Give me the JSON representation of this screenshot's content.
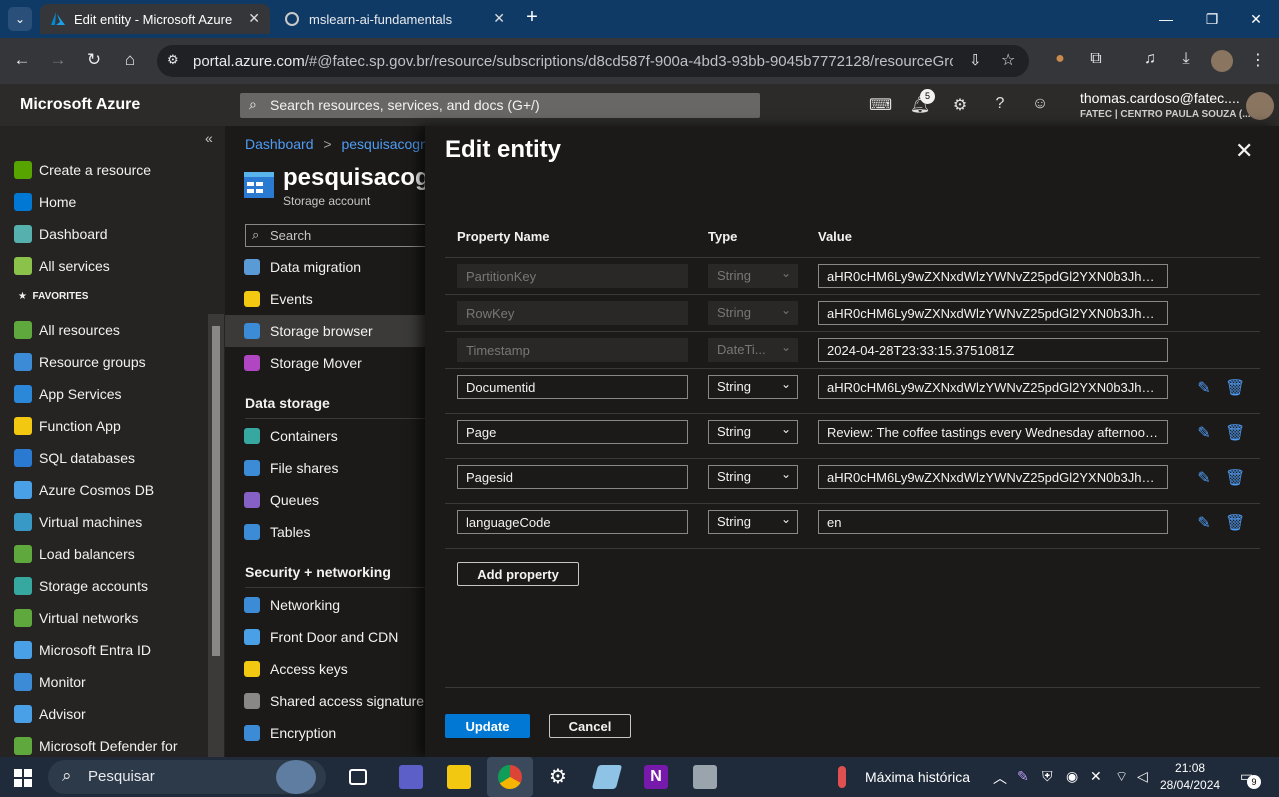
{
  "browser": {
    "tabs": [
      {
        "title": "Edit entity - Microsoft Azure",
        "active": true
      },
      {
        "title": "mslearn-ai-fundamentals",
        "active": false
      }
    ],
    "new_tab": "+",
    "url_host": "portal.azure.com",
    "url_rest": "/#@fatec.sp.gov.br/resource/subscriptions/d8cd587f-900a-4bd3-93bb-9045b7772128/resourceGroups/LA..."
  },
  "azure": {
    "brand": "Microsoft Azure",
    "search_placeholder": "Search resources, services, and docs (G+/)",
    "notification_count": "5",
    "user_name": "thomas.cardoso@fatec....",
    "user_org": "FATEC | CENTRO PAULA SOUZA (..."
  },
  "leftnav": {
    "collapse": "«",
    "top_items": [
      {
        "label": "Create a resource",
        "icon": "plus-icon",
        "color": "#57a300"
      },
      {
        "label": "Home",
        "icon": "home-icon",
        "color": "#0078d4"
      },
      {
        "label": "Dashboard",
        "icon": "dashboard-icon",
        "color": "#56b0ad"
      },
      {
        "label": "All services",
        "icon": "list-icon",
        "color": "#8bc34a"
      }
    ],
    "favorites_label": "FAVORITES",
    "favorites": [
      {
        "label": "All resources",
        "icon": "grid-icon",
        "color": "#5ea83d"
      },
      {
        "label": "Resource groups",
        "icon": "cube-icon",
        "color": "#3c8bd6"
      },
      {
        "label": "App Services",
        "icon": "globe-icon",
        "color": "#2b88d8"
      },
      {
        "label": "Function App",
        "icon": "bolt-icon",
        "color": "#f2c811"
      },
      {
        "label": "SQL databases",
        "icon": "database-icon",
        "color": "#2a7ad2"
      },
      {
        "label": "Azure Cosmos DB",
        "icon": "cosmos-icon",
        "color": "#4aa0e6"
      },
      {
        "label": "Virtual machines",
        "icon": "monitor-icon",
        "color": "#3999c6"
      },
      {
        "label": "Load balancers",
        "icon": "diamond-icon",
        "color": "#5ea83d"
      },
      {
        "label": "Storage accounts",
        "icon": "storage-icon",
        "color": "#37a8a0"
      },
      {
        "label": "Virtual networks",
        "icon": "network-icon",
        "color": "#5ea83d"
      },
      {
        "label": "Microsoft Entra ID",
        "icon": "entra-icon",
        "color": "#4aa0e6"
      },
      {
        "label": "Monitor",
        "icon": "gauge-icon",
        "color": "#3c8bd6"
      },
      {
        "label": "Advisor",
        "icon": "cloud-icon",
        "color": "#4aa0e6"
      },
      {
        "label": "Microsoft Defender for",
        "icon": "shield-icon",
        "color": "#5ea83d"
      }
    ]
  },
  "resource": {
    "breadcrumb_dashboard": "Dashboard",
    "breadcrumb_sep": ">",
    "breadcrumb_resource": "pesquisacogniti",
    "name": "pesquisacogr",
    "type": "Storage account",
    "search_placeholder": "Search",
    "menu_top": [
      {
        "label": "Data migration",
        "icon": "migration-icon",
        "color": "#5b9bd5"
      },
      {
        "label": "Events",
        "icon": "bolt-icon",
        "color": "#f2c811"
      },
      {
        "label": "Storage browser",
        "icon": "storage-browser-icon",
        "color": "#3c8bd6",
        "selected": true
      },
      {
        "label": "Storage Mover",
        "icon": "mover-icon",
        "color": "#b146c2"
      }
    ],
    "section_data_storage": "Data storage",
    "menu_data": [
      {
        "label": "Containers",
        "icon": "container-icon",
        "color": "#37a8a0"
      },
      {
        "label": "File shares",
        "icon": "file-share-icon",
        "color": "#3c8bd6"
      },
      {
        "label": "Queues",
        "icon": "queue-icon",
        "color": "#8661c5"
      },
      {
        "label": "Tables",
        "icon": "table-icon",
        "color": "#3c8bd6"
      }
    ],
    "section_security": "Security + networking",
    "menu_security": [
      {
        "label": "Networking",
        "icon": "network-icon",
        "color": "#3c8bd6"
      },
      {
        "label": "Front Door and CDN",
        "icon": "cdn-icon",
        "color": "#4aa0e6"
      },
      {
        "label": "Access keys",
        "icon": "key-icon",
        "color": "#f2c811"
      },
      {
        "label": "Shared access signature",
        "icon": "link-icon",
        "color": "#8a8886"
      },
      {
        "label": "Encryption",
        "icon": "lock-icon",
        "color": "#3c8bd6"
      }
    ]
  },
  "panel": {
    "title": "Edit entity",
    "col_property": "Property Name",
    "col_type": "Type",
    "col_value": "Value",
    "rows": [
      {
        "name": "PartitionKey",
        "type": "String",
        "value": "aHR0cHM6Ly9wZXNxdWlzYWNvZ25pdGl2YXN0b3JhZ2...",
        "editable": false
      },
      {
        "name": "RowKey",
        "type": "String",
        "value": "aHR0cHM6Ly9wZXNxdWlzYWNvZ25pdGl2YXN0b3JhZ2...",
        "editable": false
      },
      {
        "name": "Timestamp",
        "type": "DateTi...",
        "value": "2024-04-28T23:33:15.3751081Z",
        "editable": false
      },
      {
        "name": "Documentid",
        "type": "String",
        "value": "aHR0cHM6Ly9wZXNxdWlzYWNvZ25pdGl2YXN0b3JhZ2...",
        "editable": true
      },
      {
        "name": "Page",
        "type": "String",
        "value": "Review: The coffee tastings every Wednesday afternoon ...",
        "editable": true
      },
      {
        "name": "Pagesid",
        "type": "String",
        "value": "aHR0cHM6Ly9wZXNxdWlzYWNvZ25pdGl2YXN0b3JhZ2...",
        "editable": true
      },
      {
        "name": "languageCode",
        "type": "String",
        "value": "en",
        "editable": true
      }
    ],
    "add_property": "Add property",
    "update": "Update",
    "cancel": "Cancel"
  },
  "taskbar": {
    "search_placeholder": "Pesquisar",
    "weather": "Máxima histórica",
    "time": "21:08",
    "date": "28/04/2024",
    "notif_count": "9"
  }
}
